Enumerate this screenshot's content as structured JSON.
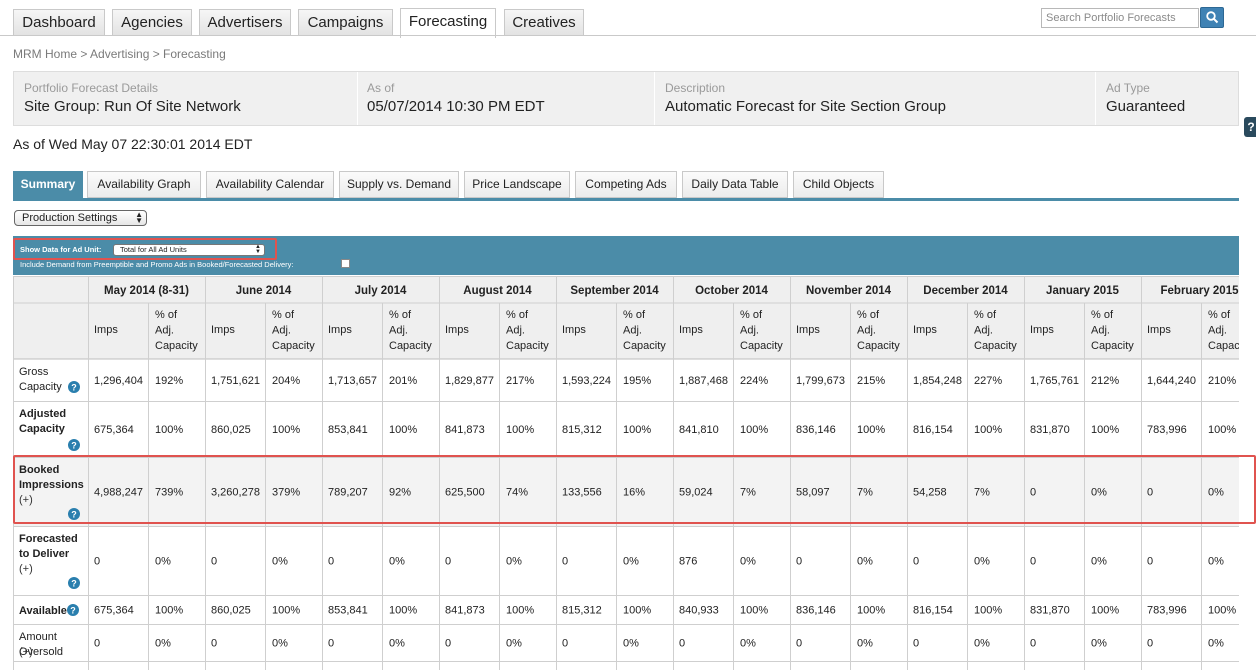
{
  "nav": {
    "tabs": [
      "Dashboard",
      "Agencies",
      "Advertisers",
      "Campaigns",
      "Forecasting",
      "Creatives"
    ],
    "active_tab": "Forecasting",
    "search_placeholder": "Search Portfolio Forecasts",
    "search_icon": "search-icon"
  },
  "breadcrumb": "MRM Home > Advertising > Forecasting",
  "details": {
    "portfolio_label": "Portfolio Forecast Details",
    "portfolio_value": "Site Group: Run Of Site Network",
    "asof_label": "As of",
    "asof_value": "05/07/2014 10:30 PM EDT",
    "desc_label": "Description",
    "desc_value": "Automatic Forecast for Site Section Group",
    "adtype_label": "Ad Type",
    "adtype_value": "Guaranteed"
  },
  "help_side": "?",
  "as_of_line": "As of Wed May 07 22:30:01 2014 EDT",
  "subtabs": [
    "Summary",
    "Availability Graph",
    "Availability Calendar",
    "Supply vs. Demand",
    "Price Landscape",
    "Competing Ads",
    "Daily Data Table",
    "Child Objects"
  ],
  "active_subtab": "Summary",
  "production_settings": "Production Settings",
  "filter": {
    "show_label": "Show Data for Ad Unit:",
    "ad_unit_value": "Total for All Ad Units",
    "include_label": "Include Demand from Preemptible and Promo Ads in Booked/Forecasted Delivery:"
  },
  "table": {
    "months": [
      "May 2014 (8-31)",
      "June 2014",
      "July 2014",
      "August 2014",
      "September 2014",
      "October 2014",
      "November 2014",
      "December 2014",
      "January 2015",
      "February 2015"
    ],
    "subheaders": [
      "Imps",
      "% of Adj. Capacity"
    ],
    "rows": [
      {
        "label": "Gross Capacity",
        "expand": "",
        "help": true,
        "values": [
          [
            "1,296,404",
            "192%"
          ],
          [
            "1,751,621",
            "204%"
          ],
          [
            "1,713,657",
            "201%"
          ],
          [
            "1,829,877",
            "217%"
          ],
          [
            "1,593,224",
            "195%"
          ],
          [
            "1,887,468",
            "224%"
          ],
          [
            "1,799,673",
            "215%"
          ],
          [
            "1,854,248",
            "227%"
          ],
          [
            "1,765,761",
            "212%"
          ],
          [
            "1,644,240",
            "210%"
          ]
        ]
      },
      {
        "label": "Adjusted Capacity",
        "expand": "",
        "help": true,
        "bold": true,
        "values": [
          [
            "675,364",
            "100%"
          ],
          [
            "860,025",
            "100%"
          ],
          [
            "853,841",
            "100%"
          ],
          [
            "841,873",
            "100%"
          ],
          [
            "815,312",
            "100%"
          ],
          [
            "841,810",
            "100%"
          ],
          [
            "836,146",
            "100%"
          ],
          [
            "816,154",
            "100%"
          ],
          [
            "831,870",
            "100%"
          ],
          [
            "783,996",
            "100%"
          ]
        ]
      },
      {
        "label": "Booked Impressions",
        "expand": "(+)",
        "help": true,
        "bold": true,
        "values": [
          [
            "4,988,247",
            "739%"
          ],
          [
            "3,260,278",
            "379%"
          ],
          [
            "789,207",
            "92%"
          ],
          [
            "625,500",
            "74%"
          ],
          [
            "133,556",
            "16%"
          ],
          [
            "59,024",
            "7%"
          ],
          [
            "58,097",
            "7%"
          ],
          [
            "54,258",
            "7%"
          ],
          [
            "0",
            "0%"
          ],
          [
            "0",
            "0%"
          ]
        ]
      },
      {
        "label": "Forecasted to Deliver",
        "expand": "(+)",
        "help": true,
        "bold": true,
        "values": [
          [
            "0",
            "0%"
          ],
          [
            "0",
            "0%"
          ],
          [
            "0",
            "0%"
          ],
          [
            "0",
            "0%"
          ],
          [
            "0",
            "0%"
          ],
          [
            "876",
            "0%"
          ],
          [
            "0",
            "0%"
          ],
          [
            "0",
            "0%"
          ],
          [
            "0",
            "0%"
          ],
          [
            "0",
            "0%"
          ]
        ]
      },
      {
        "label": "Available",
        "expand": "",
        "help": true,
        "bold": true,
        "values": [
          [
            "675,364",
            "100%"
          ],
          [
            "860,025",
            "100%"
          ],
          [
            "853,841",
            "100%"
          ],
          [
            "841,873",
            "100%"
          ],
          [
            "815,312",
            "100%"
          ],
          [
            "840,933",
            "100%"
          ],
          [
            "836,146",
            "100%"
          ],
          [
            "816,154",
            "100%"
          ],
          [
            "831,870",
            "100%"
          ],
          [
            "783,996",
            "100%"
          ]
        ]
      },
      {
        "label": "Amount Oversold",
        "expand": "(+)",
        "help": false,
        "values": [
          [
            "0",
            "0%"
          ],
          [
            "0",
            "0%"
          ],
          [
            "0",
            "0%"
          ],
          [
            "0",
            "0%"
          ],
          [
            "0",
            "0%"
          ],
          [
            "0",
            "0%"
          ],
          [
            "0",
            "0%"
          ],
          [
            "0",
            "0%"
          ],
          [
            "0",
            "0%"
          ],
          [
            "0",
            "0%"
          ]
        ]
      }
    ]
  }
}
